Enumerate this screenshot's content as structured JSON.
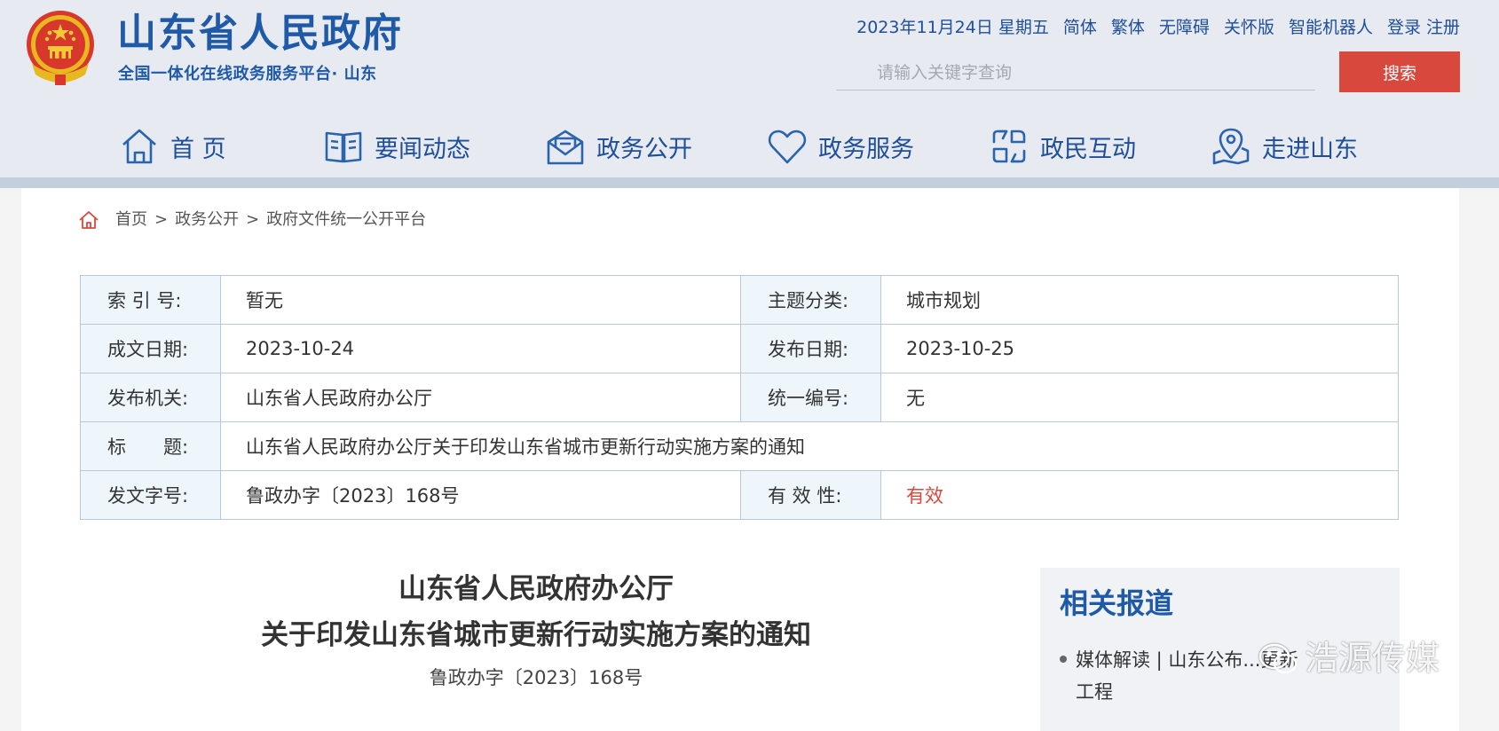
{
  "header": {
    "title": "山东省人民政府",
    "subtitle": "全国一体化在线政务服务平台· 山东",
    "date": "2023年11月24日 星期五",
    "links": [
      "简体",
      "繁体",
      "无障碍",
      "关怀版",
      "智能机器人",
      "登录 注册"
    ],
    "search_placeholder": "请输入关键字查询",
    "search_button": "搜索"
  },
  "nav": [
    {
      "label": "首 页",
      "icon": "home-icon"
    },
    {
      "label": "要闻动态",
      "icon": "book-icon"
    },
    {
      "label": "政务公开",
      "icon": "mail-icon"
    },
    {
      "label": "政务服务",
      "icon": "heart-icon"
    },
    {
      "label": "政民互动",
      "icon": "exchange-icon"
    },
    {
      "label": "走进山东",
      "icon": "location-icon"
    }
  ],
  "breadcrumb": [
    "首页",
    "政务公开",
    "政府文件统一公开平台"
  ],
  "meta": {
    "index_no_label": "索 引 号:",
    "index_no": "暂无",
    "topic_label": "主题分类:",
    "topic": "城市规划",
    "written_label": "成文日期:",
    "written": "2023-10-24",
    "published_label": "发布日期:",
    "published": "2023-10-25",
    "issuer_label": "发布机关:",
    "issuer": "山东省人民政府办公厅",
    "code_label": "统一编号:",
    "code": "无",
    "title_label": "标　　题:",
    "title": "山东省人民政府办公厅关于印发山东省城市更新行动实施方案的通知",
    "doc_no_label": "发文字号:",
    "doc_no": "鲁政办字〔2023〕168号",
    "validity_label": "有 效 性:",
    "validity": "有效"
  },
  "document": {
    "title_line1": "山东省人民政府办公厅",
    "title_line2": "关于印发山东省城市更新行动实施方案的通知",
    "number": "鲁政办字〔2023〕168号"
  },
  "related": {
    "heading": "相关报道",
    "item_line1": "媒体解读 | 山东公布...更新",
    "item_line2": "工程"
  },
  "watermark": "浩源传媒",
  "colors": {
    "brand_blue": "#1f5aa8",
    "accent_red": "#d8483c",
    "header_bg": "#e7eaf0"
  }
}
